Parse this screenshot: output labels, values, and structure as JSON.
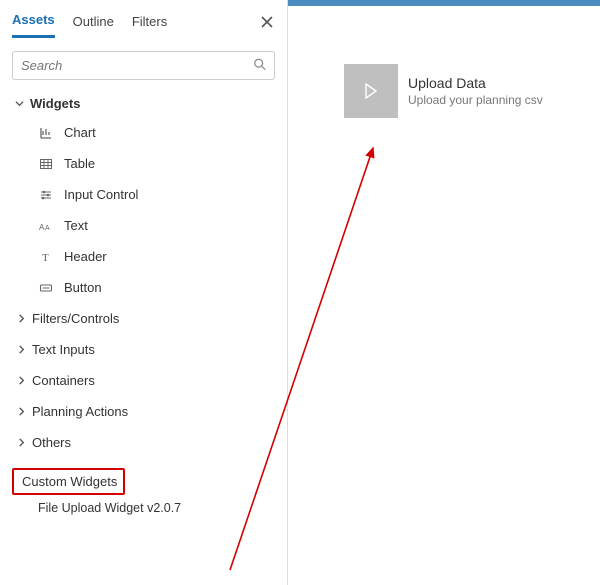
{
  "tabs": {
    "assets": "Assets",
    "outline": "Outline",
    "filters": "Filters"
  },
  "search": {
    "placeholder": "Search"
  },
  "tree": {
    "widgets_label": "Widgets",
    "widgets": [
      "Chart",
      "Table",
      "Input Control",
      "Text",
      "Header",
      "Button"
    ],
    "categories": [
      "Filters/Controls",
      "Text Inputs",
      "Containers",
      "Planning Actions",
      "Others"
    ],
    "custom_widgets_label": "Custom Widgets",
    "custom_widgets_child": "File Upload Widget v2.0.7"
  },
  "canvas": {
    "widget_title": "Upload Data",
    "widget_subtitle": "Upload your planning csv"
  }
}
